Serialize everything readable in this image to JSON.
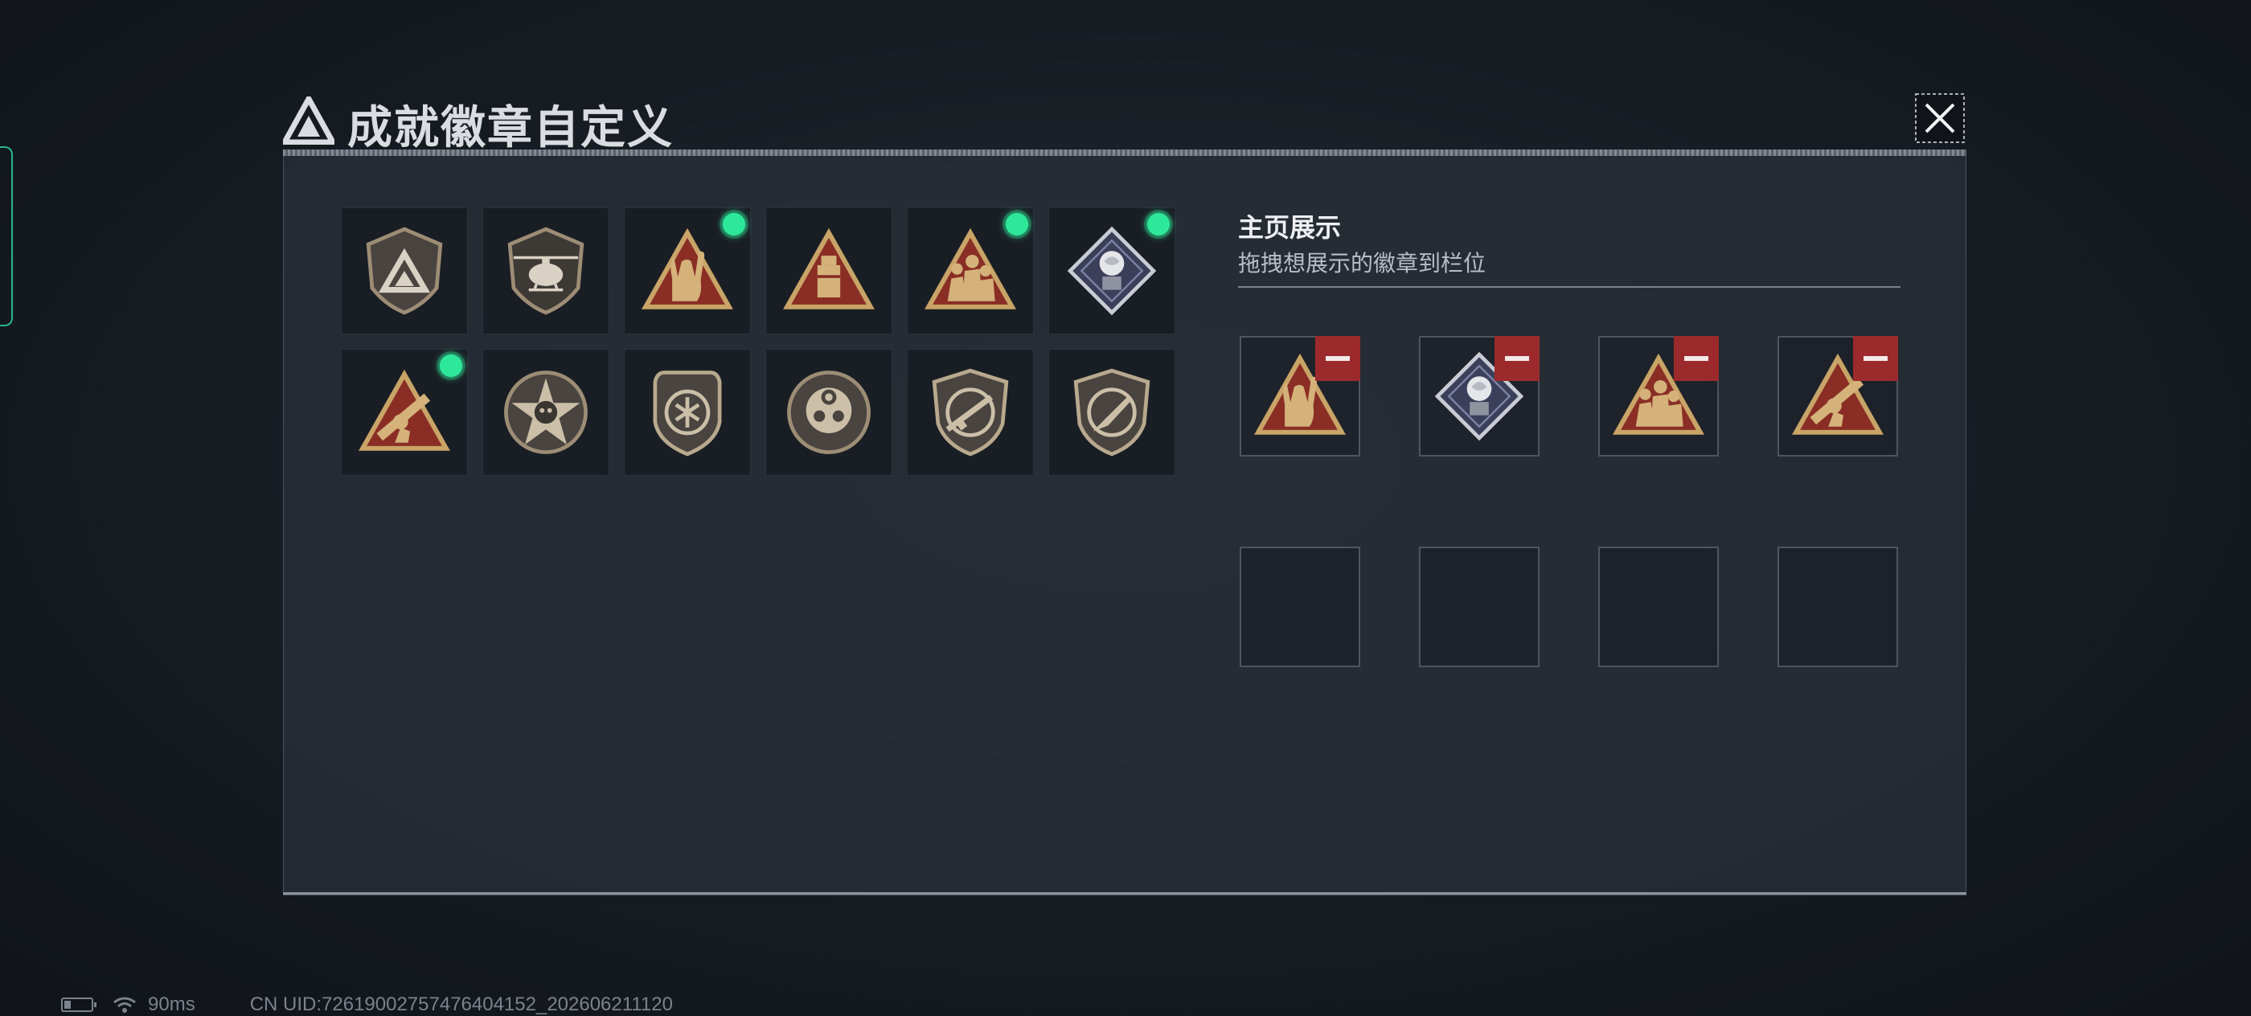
{
  "window": {
    "title": "成就徽章自定义",
    "close_icon": "close-icon",
    "logo_icon": "triangle-logo-icon"
  },
  "colors": {
    "accent_green": "#2ee89a",
    "remove_red": "#9c2a2c",
    "badge_gold": "#c9a467",
    "badge_red": "#8a2e25"
  },
  "badges": [
    {
      "icon": "shield-triangle-badge-icon",
      "equipped": false
    },
    {
      "icon": "helicopter-shield-badge-icon",
      "equipped": false
    },
    {
      "icon": "rock-hand-triangle-badge-icon",
      "equipped": true
    },
    {
      "icon": "supply-crate-triangle-badge-icon",
      "equipped": false
    },
    {
      "icon": "squad-triangle-badge-icon",
      "equipped": true
    },
    {
      "icon": "rose-diamond-badge-icon",
      "equipped": true
    },
    {
      "icon": "rocket-launcher-triangle-badge-icon",
      "equipped": true
    },
    {
      "icon": "star-skull-round-badge-icon",
      "equipped": false
    },
    {
      "icon": "wing-shield-badge-icon",
      "equipped": false
    },
    {
      "icon": "crosshair-mech-round-badge-icon",
      "equipped": false
    },
    {
      "icon": "rifle-shield-badge-icon",
      "equipped": false
    },
    {
      "icon": "knife-shield-badge-icon",
      "equipped": false
    }
  ],
  "showcase": {
    "title": "主页展示",
    "subtitle": "拖拽想展示的徽章到栏位",
    "slots": [
      {
        "icon": "rock-hand-triangle-badge-icon",
        "filled": true
      },
      {
        "icon": "rose-diamond-badge-icon",
        "filled": true
      },
      {
        "icon": "squad-triangle-badge-icon",
        "filled": true
      },
      {
        "icon": "rocket-launcher-triangle-badge-icon",
        "filled": true
      },
      {
        "icon": "",
        "filled": false
      },
      {
        "icon": "",
        "filled": false
      },
      {
        "icon": "",
        "filled": false
      },
      {
        "icon": "",
        "filled": false
      }
    ]
  },
  "status_bar": {
    "ping": "90ms",
    "uid": "CN UID:7261900275747640415​2_202606211120"
  }
}
